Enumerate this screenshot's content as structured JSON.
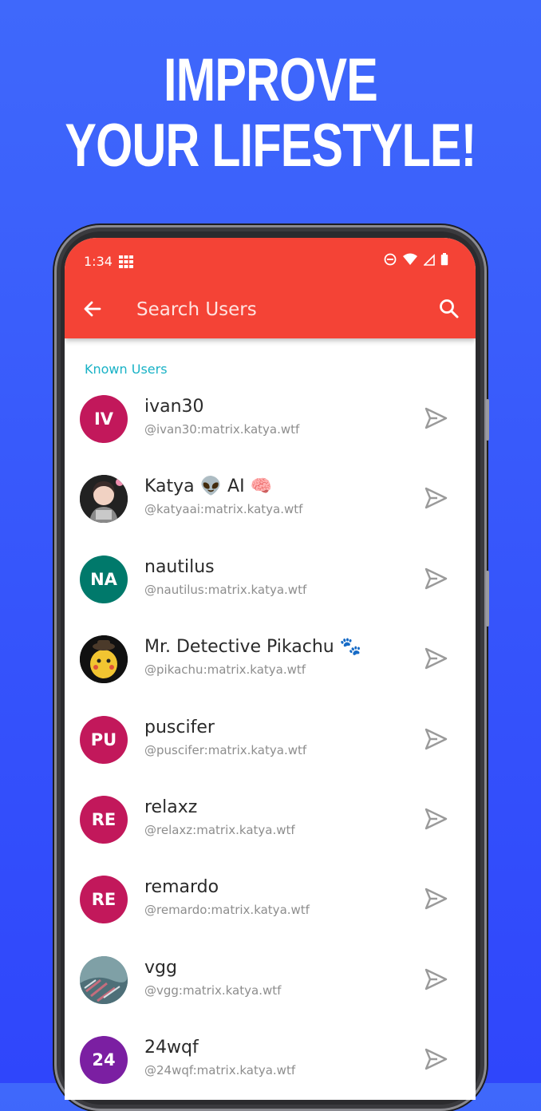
{
  "headline": {
    "line1": "IMPROVE",
    "line2": "YOUR LIFESTYLE!"
  },
  "status_bar": {
    "time": "1:34"
  },
  "toolbar": {
    "title": "Search Users"
  },
  "section_label": "Known Users",
  "users": [
    {
      "name": "ivan30",
      "handle": "@ivan30:matrix.katya.wtf",
      "initials": "IV",
      "avatar_color": "#c2185b",
      "avatar_type": "initials"
    },
    {
      "name": "Katya 👽 AI 🧠",
      "handle": "@katyaai:matrix.katya.wtf",
      "initials": "",
      "avatar_color": "#1a1a1a",
      "avatar_type": "photo"
    },
    {
      "name": "nautilus",
      "handle": "@nautilus:matrix.katya.wtf",
      "initials": "NA",
      "avatar_color": "#00796b",
      "avatar_type": "initials"
    },
    {
      "name": "Mr. Detective Pikachu 🐾",
      "handle": "@pikachu:matrix.katya.wtf",
      "initials": "",
      "avatar_color": "#0f0f0f",
      "avatar_type": "photo"
    },
    {
      "name": "puscifer",
      "handle": "@puscifer:matrix.katya.wtf",
      "initials": "PU",
      "avatar_color": "#c2185b",
      "avatar_type": "initials"
    },
    {
      "name": "relaxz",
      "handle": "@relaxz:matrix.katya.wtf",
      "initials": "RE",
      "avatar_color": "#c2185b",
      "avatar_type": "initials"
    },
    {
      "name": "remardo",
      "handle": "@remardo:matrix.katya.wtf",
      "initials": "RE",
      "avatar_color": "#c2185b",
      "avatar_type": "initials"
    },
    {
      "name": "vgg",
      "handle": "@vgg:matrix.katya.wtf",
      "initials": "",
      "avatar_color": "#6f8f95",
      "avatar_type": "photo"
    },
    {
      "name": "24wqf",
      "handle": "@24wqf:matrix.katya.wtf",
      "initials": "24",
      "avatar_color": "#7b1fa2",
      "avatar_type": "initials"
    }
  ],
  "colors": {
    "appbar": "#f44336",
    "accent": "#19b2c6",
    "background": "#3655fb"
  }
}
